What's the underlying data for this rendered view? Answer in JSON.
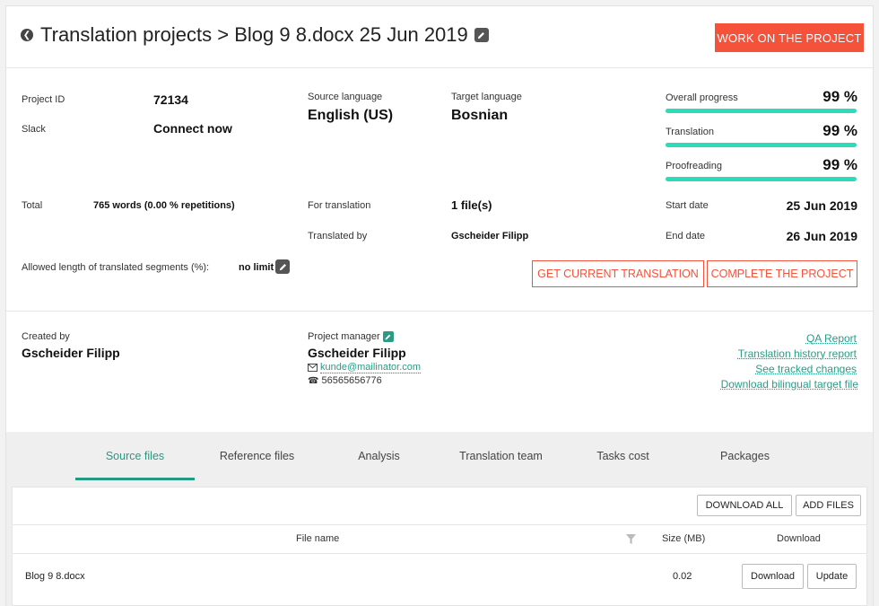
{
  "header": {
    "title": "Translation projects > Blog 9 8.docx 25 Jun 2019",
    "work_button": "WORK ON THE PROJECT"
  },
  "info": {
    "project_id_label": "Project ID",
    "project_id": "72134",
    "slack_label": "Slack",
    "slack_value": "Connect now",
    "source_lang_label": "Source language",
    "source_lang": "English (US)",
    "target_lang_label": "Target language",
    "target_lang": "Bosnian",
    "total_label": "Total",
    "total_value": "765 words (0.00 % repetitions)",
    "for_translation_label": "For translation",
    "for_translation": "1 file(s)",
    "translated_by_label": "Translated by",
    "translated_by": "Gscheider Filipp",
    "allowed_length_label": "Allowed length of translated segments (%):",
    "allowed_length": "no limit",
    "start_date_label": "Start date",
    "start_date": "25 Jun 2019",
    "end_date_label": "End date",
    "end_date": "26 Jun 2019"
  },
  "progress": {
    "overall_label": "Overall progress",
    "overall": "99 %",
    "overall_value": 99,
    "translation_label": "Translation",
    "translation": "99 %",
    "translation_value": 99,
    "proofreading_label": "Proofreading",
    "proofreading": "99 %",
    "proofreading_value": 99
  },
  "actions": {
    "get_translation": "GET CURRENT TRANSLATION",
    "complete": "COMPLETE THE PROJECT"
  },
  "people": {
    "created_by_label": "Created by",
    "created_by": "Gscheider Filipp",
    "pm_label": "Project manager",
    "pm_name": "Gscheider Filipp",
    "pm_email": "kunde@mailinator.com",
    "pm_phone": "56565656776"
  },
  "reports": {
    "qa": "QA Report",
    "history": "Translation history report",
    "tracked": "See tracked changes",
    "bilingual": "Download bilingual target file"
  },
  "tabs": [
    "Source files",
    "Reference files",
    "Analysis",
    "Translation team",
    "Tasks cost",
    "Packages"
  ],
  "files": {
    "download_all": "DOWNLOAD ALL",
    "add_files": "ADD FILES",
    "col_name": "File name",
    "col_size": "Size (MB)",
    "col_download": "Download",
    "rows": [
      {
        "name": "Blog 9 8.docx",
        "size": "0.02",
        "download": "Download",
        "update": "Update"
      }
    ]
  },
  "colors": {
    "accent_red": "#f4523b",
    "accent_teal": "#2ddbb9",
    "link": "#2a9c85"
  },
  "icons": [
    "back-circle-icon",
    "pencil-icon",
    "envelope-icon",
    "phone-icon",
    "filter-icon"
  ]
}
